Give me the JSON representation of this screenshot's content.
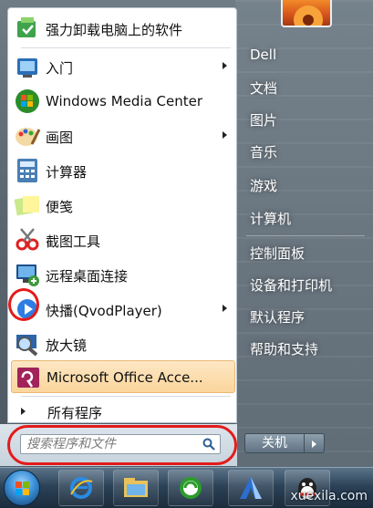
{
  "start_menu": {
    "programs": [
      {
        "label": "强力卸载电脑上的软件",
        "icon": "uninstall-icon",
        "submenu": false
      },
      {
        "label": "入门",
        "icon": "getting-started-icon",
        "submenu": true
      },
      {
        "label": "Windows Media Center",
        "icon": "media-center-icon",
        "submenu": false
      },
      {
        "label": "画图",
        "icon": "paint-icon",
        "submenu": true
      },
      {
        "label": "计算器",
        "icon": "calculator-icon",
        "submenu": false
      },
      {
        "label": "便笺",
        "icon": "sticky-notes-icon",
        "submenu": false
      },
      {
        "label": "截图工具",
        "icon": "snipping-tool-icon",
        "submenu": false
      },
      {
        "label": "远程桌面连接",
        "icon": "remote-desktop-icon",
        "submenu": false
      },
      {
        "label": "快播(QvodPlayer)",
        "icon": "qvod-player-icon",
        "submenu": true
      },
      {
        "label": "放大镜",
        "icon": "magnifier-icon",
        "submenu": false
      },
      {
        "label": "Microsoft Office Acce...",
        "icon": "access-icon",
        "submenu": false
      }
    ],
    "all_programs_label": "所有程序",
    "search": {
      "placeholder": "搜索程序和文件"
    },
    "right_items": [
      "Dell",
      "文档",
      "图片",
      "音乐",
      "游戏",
      "计算机",
      "控制面板",
      "设备和打印机",
      "默认程序",
      "帮助和支持"
    ],
    "shutdown_label": "关机"
  },
  "taskbar": {
    "pinned": [
      "internet-explorer-icon",
      "windows-explorer-icon",
      "media-player-icon",
      "vnc-app-icon",
      "qq-icon"
    ],
    "watermark": "xuexila.com"
  },
  "colors": {
    "highlight": "#fbd59c",
    "annotation": "#e31b1b"
  }
}
